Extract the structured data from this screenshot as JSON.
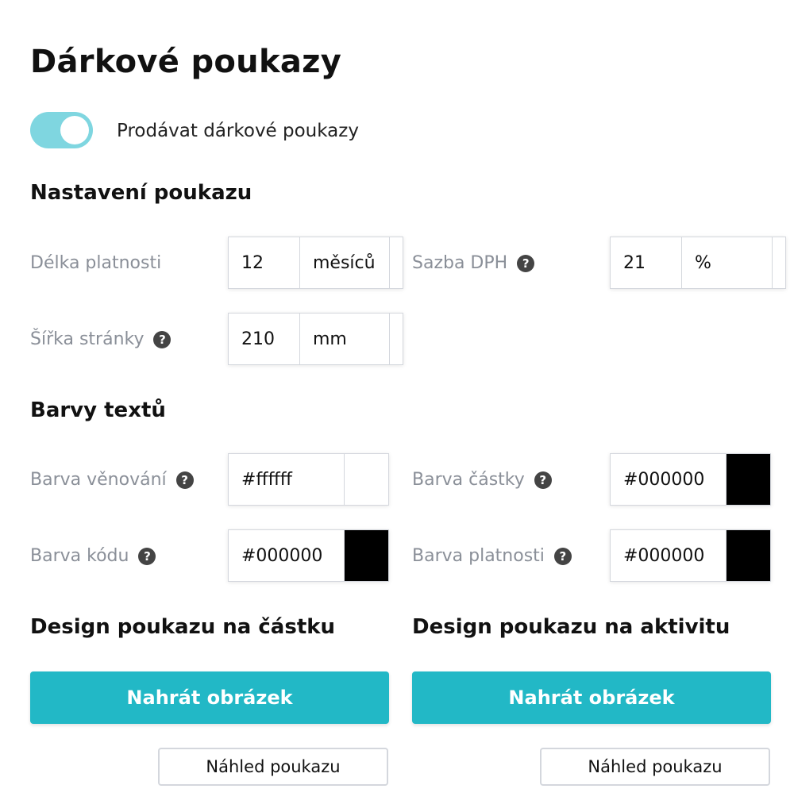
{
  "page": {
    "title": "Dárkové poukazy"
  },
  "toggle": {
    "label": "Prodávat dárkové poukazy",
    "checked": true,
    "color": "#7fd6e0"
  },
  "voucher_settings": {
    "heading": "Nastavení poukazu",
    "validity": {
      "label": "Délka platnosti",
      "value": "12",
      "unit": "měsíců"
    },
    "vat": {
      "label": "Sazba DPH",
      "value": "21",
      "unit": "%",
      "help_icon": "question-circle-icon"
    },
    "page_width": {
      "label": "Šířka stránky",
      "value": "210",
      "unit": "mm",
      "help_icon": "question-circle-icon"
    }
  },
  "text_colors": {
    "heading": "Barvy textů",
    "dedication": {
      "label": "Barva věnování",
      "value": "#ffffff",
      "swatch": "#ffffff"
    },
    "amount": {
      "label": "Barva částky",
      "value": "#000000",
      "swatch": "#000000"
    },
    "code": {
      "label": "Barva kódu",
      "value": "#000000",
      "swatch": "#000000"
    },
    "validity": {
      "label": "Barva platnosti",
      "value": "#000000",
      "swatch": "#000000"
    }
  },
  "design_amount": {
    "heading": "Design poukazu na částku",
    "upload_label": "Nahrát obrázek",
    "preview_label": "Náhled poukazu"
  },
  "design_activity": {
    "heading": "Design poukazu na aktivitu",
    "upload_label": "Nahrát obrázek",
    "preview_label": "Náhled poukazu"
  },
  "colors": {
    "accent": "#22b8c6",
    "help_icon": "#444444",
    "label_text": "#8a8f98"
  }
}
